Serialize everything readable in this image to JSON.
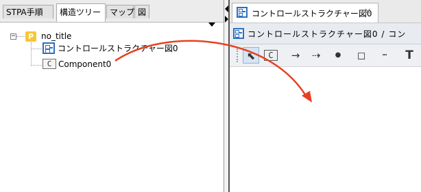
{
  "left_tabs": [
    {
      "label": "STPA手順"
    },
    {
      "label": "構造ツリー"
    },
    {
      "label": "マップ"
    },
    {
      "label": "図"
    }
  ],
  "tree": {
    "root": {
      "label": "no_title",
      "icon": "project-icon",
      "icon_glyph": "P"
    },
    "children": [
      {
        "label": "コントロールストラクチャー図0",
        "icon": "control-structure-diagram-icon"
      },
      {
        "label": "Component0",
        "icon": "component-icon",
        "icon_glyph": "C"
      }
    ],
    "expander_glyph": "−"
  },
  "editor": {
    "tab_label": "コントロールストラクチャー図0",
    "close_glyph": "✕",
    "title": "コントロールストラクチャー図0 / コン"
  },
  "toolbar": {
    "tools": [
      {
        "name": "select-tool",
        "glyph": "⬉"
      },
      {
        "name": "component-tool",
        "glyph": "C"
      },
      {
        "name": "control-action-tool",
        "glyph": "→"
      },
      {
        "name": "feedback-tool",
        "glyph": "⇢"
      },
      {
        "name": "point-tool",
        "glyph": "●"
      },
      {
        "name": "note-tool",
        "glyph": "◻"
      },
      {
        "name": "dotted-line-tool",
        "glyph": "┅"
      },
      {
        "name": "text-tool",
        "glyph": "T"
      }
    ]
  },
  "colors": {
    "drag_arrow": "#e8401f",
    "diagram_icon": "#2b6fbf",
    "project_icon": "#f7c733"
  }
}
